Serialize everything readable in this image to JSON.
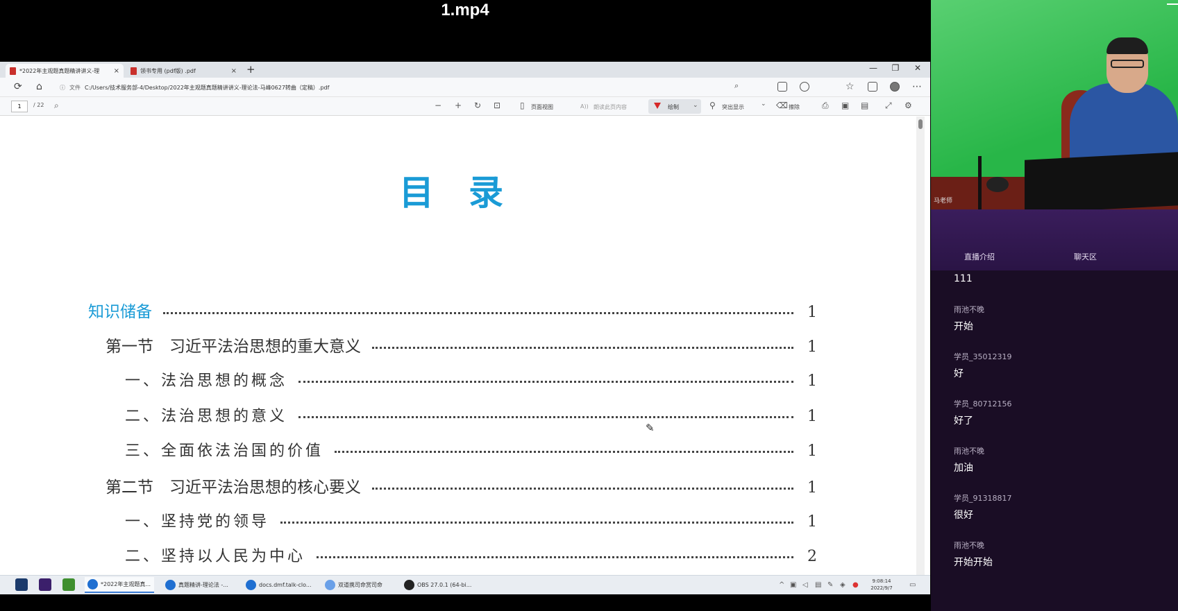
{
  "video_title": "1.mp4",
  "browser": {
    "tabs": [
      {
        "label": "*2022年主观题真题精讲讲义-理",
        "close": "×"
      },
      {
        "label": "领书专用 (pdf版) .pdf",
        "close": "×"
      }
    ],
    "new_tab": "+",
    "window_controls": [
      "—",
      "❐",
      "✕"
    ],
    "url_prefix": "文件",
    "url": "C:/Users/技术服务部-4/Desktop/2022年主观题真题精讲讲义-理论法-马峰0627转曲（定稿）.pdf"
  },
  "pdf_toolbar": {
    "page": "1",
    "total": "/ 22",
    "page_view": "页面视图",
    "read_aloud": "朗读此页内容",
    "draw": "绘制",
    "highlight": "突出显示",
    "erase": "擦除"
  },
  "document": {
    "title": "目录",
    "toc": [
      {
        "text": "知识储备",
        "page": "1",
        "level": "part"
      },
      {
        "text": "第一节　习近平法治思想的重大意义",
        "page": "1",
        "level": "section"
      },
      {
        "text": "一、法治思想的概念",
        "page": "1",
        "level": "sub"
      },
      {
        "text": "二、法治思想的意义",
        "page": "1",
        "level": "sub"
      },
      {
        "text": "三、全面依法治国的价值",
        "page": "1",
        "level": "sub"
      },
      {
        "text": "第二节　习近平法治思想的核心要义",
        "page": "1",
        "level": "section"
      },
      {
        "text": "一、坚持党的领导",
        "page": "1",
        "level": "sub"
      },
      {
        "text": "二、坚持以人民为中心",
        "page": "2",
        "level": "sub"
      }
    ]
  },
  "taskbar": {
    "items": [
      {
        "label": "*2022年主观题真...",
        "color": "#1f6fd1"
      },
      {
        "label": "真题精讲-理论法 -...",
        "color": "#1f6fd1"
      },
      {
        "label": "docs.dmf.talk-clo...",
        "color": "#1f6fd1"
      },
      {
        "label": "双道携司命赏司命",
        "color": "#6aa0e8"
      },
      {
        "label": "OBS 27.0.1 (64-bi...",
        "color": "#222222"
      }
    ],
    "time": "9:08:14",
    "date": "2022/9/7"
  },
  "live": {
    "watermark": "马老师",
    "tabs": [
      "直播介绍",
      "聊天区"
    ],
    "messages": [
      {
        "user": "",
        "text": "111"
      },
      {
        "user": "雨池不晚",
        "text": "开始"
      },
      {
        "user": "学员_35012319",
        "text": "好"
      },
      {
        "user": "学员_80712156",
        "text": "好了"
      },
      {
        "user": "雨池不晚",
        "text": "加油"
      },
      {
        "user": "学员_91318817",
        "text": "很好"
      },
      {
        "user": "雨池不晚",
        "text": "开始开始"
      }
    ]
  }
}
